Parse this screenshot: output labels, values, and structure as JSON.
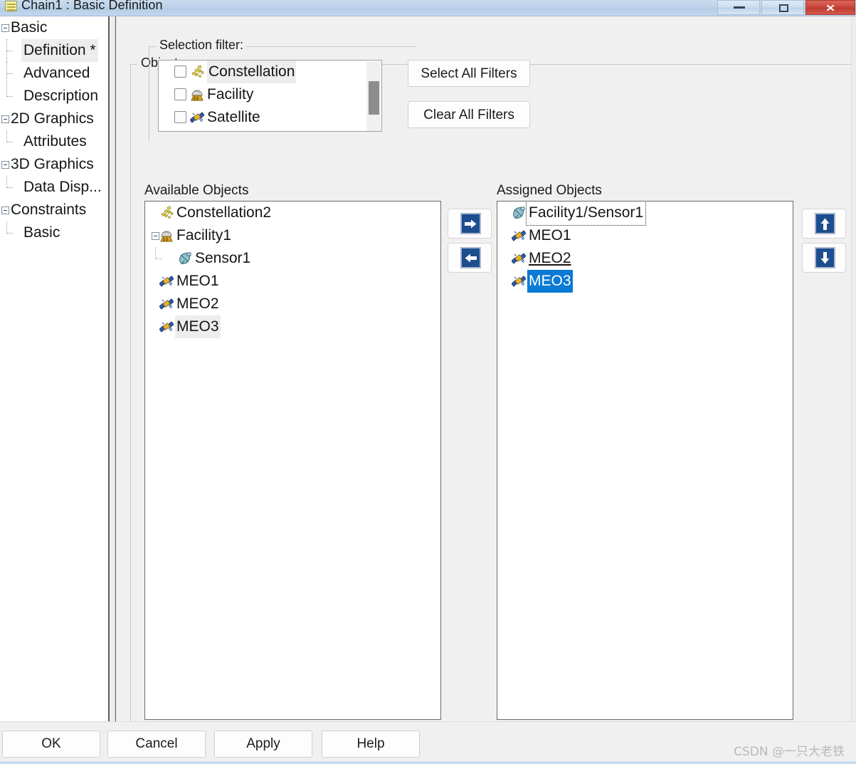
{
  "window": {
    "title": "Chain1 : Basic Definition",
    "title_icon": "chain-icon",
    "controls": {
      "minimize": "–",
      "maximize": "❐",
      "close": "✕"
    }
  },
  "sidebar": {
    "items": [
      {
        "label": "Basic",
        "level": 0,
        "expandable": true,
        "selected": false
      },
      {
        "label": "Definition *",
        "level": 1,
        "expandable": false,
        "selected": true
      },
      {
        "label": "Advanced",
        "level": 1,
        "expandable": false,
        "selected": false
      },
      {
        "label": "Description",
        "level": 1,
        "expandable": false,
        "selected": false
      },
      {
        "label": "2D Graphics",
        "level": 0,
        "expandable": true,
        "selected": false
      },
      {
        "label": "Attributes",
        "level": 1,
        "expandable": false,
        "selected": false
      },
      {
        "label": "3D Graphics",
        "level": 0,
        "expandable": true,
        "selected": false
      },
      {
        "label": "Data Disp...",
        "level": 1,
        "expandable": false,
        "selected": false
      },
      {
        "label": "Constraints",
        "level": 0,
        "expandable": true,
        "selected": false
      },
      {
        "label": "Basic",
        "level": 1,
        "expandable": false,
        "selected": false
      }
    ]
  },
  "main": {
    "objects_group_label": "Objects",
    "filter_group_label": "Selection filter:",
    "filter_items": [
      {
        "label": "Constellation",
        "icon": "constellation-icon",
        "checked": false,
        "highlighted": true
      },
      {
        "label": "Facility",
        "icon": "facility-icon",
        "checked": false,
        "highlighted": false
      },
      {
        "label": "Satellite",
        "icon": "satellite-icon",
        "checked": false,
        "highlighted": false
      }
    ],
    "select_all_filters_label": "Select All Filters",
    "clear_all_filters_label": "Clear All Filters",
    "available_caption": "Available Objects",
    "assigned_caption": "Assigned Objects",
    "available_objects": [
      {
        "label": "Constellation2",
        "icon": "constellation-icon",
        "indent": 0,
        "expandable": false,
        "state": "normal"
      },
      {
        "label": "Facility1",
        "icon": "facility-icon",
        "indent": 0,
        "expandable": true,
        "state": "normal"
      },
      {
        "label": "Sensor1",
        "icon": "sensor-icon",
        "indent": 1,
        "expandable": false,
        "state": "normal"
      },
      {
        "label": "MEO1",
        "icon": "satellite-icon",
        "indent": 0,
        "expandable": false,
        "state": "normal"
      },
      {
        "label": "MEO2",
        "icon": "satellite-icon",
        "indent": 0,
        "expandable": false,
        "state": "normal"
      },
      {
        "label": "MEO3",
        "icon": "satellite-icon",
        "indent": 0,
        "expandable": false,
        "state": "hl-gray"
      }
    ],
    "assigned_objects": [
      {
        "label": "Facility1/Sensor1",
        "icon": "sensor-icon",
        "indent": 0,
        "state": "focusbox"
      },
      {
        "label": "MEO1",
        "icon": "satellite-icon",
        "indent": 0,
        "state": "normal"
      },
      {
        "label": "MEO2",
        "icon": "satellite-icon",
        "indent": 0,
        "state": "underline"
      },
      {
        "label": "MEO3",
        "icon": "satellite-icon",
        "indent": 0,
        "state": "hl-blue"
      }
    ],
    "transfer_buttons": [
      {
        "name": "move-right-button",
        "icon": "arrow-right-icon",
        "glyph": "➔"
      },
      {
        "name": "move-left-button",
        "icon": "arrow-left-icon",
        "glyph": "⬅"
      }
    ],
    "reorder_buttons": [
      {
        "name": "move-up-button",
        "icon": "arrow-up-icon",
        "glyph": "⬆"
      },
      {
        "name": "move-down-button",
        "icon": "arrow-down-icon",
        "glyph": "⬇"
      }
    ]
  },
  "footer": {
    "ok_label": "OK",
    "cancel_label": "Cancel",
    "apply_label": "Apply",
    "help_label": "Help",
    "watermark": "CSDN @一只大老铁"
  },
  "colors": {
    "selection_blue": "#0a7ad4",
    "button_blue": "#1c4d8f",
    "titlebar_blue": "#bdd3ea",
    "close_red": "#c9453a",
    "row_highlight_gray": "#ededed"
  }
}
